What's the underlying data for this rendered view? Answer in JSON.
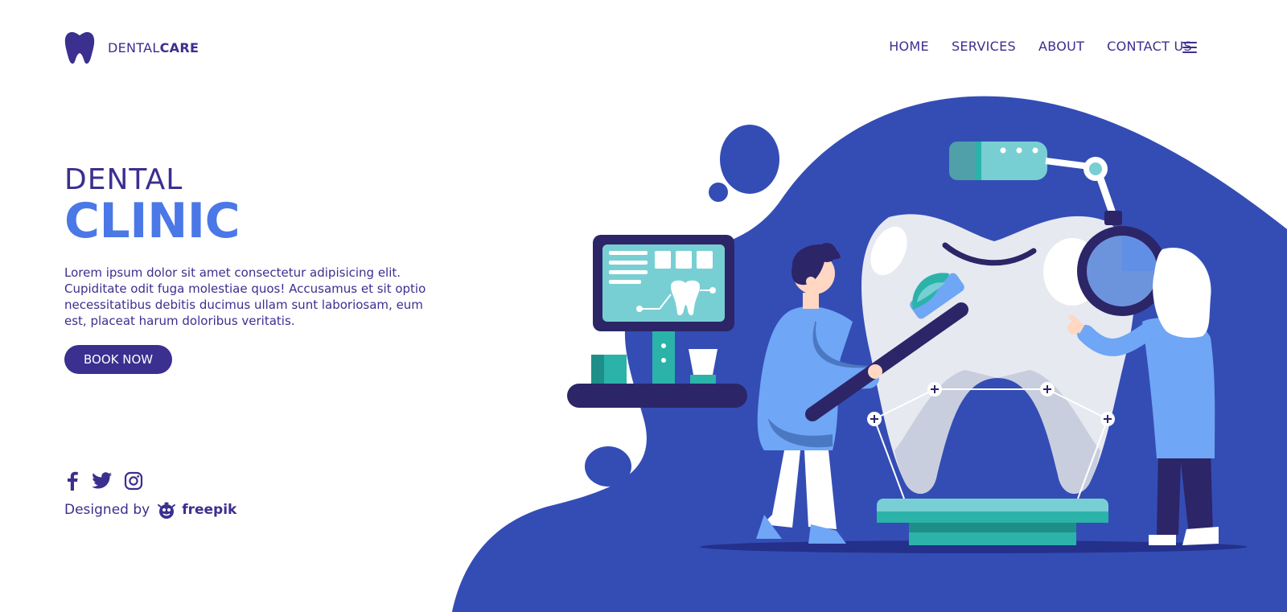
{
  "brand": {
    "name_light": "DENTAL",
    "name_bold": "CARE",
    "logo_icon": "tooth-icon"
  },
  "nav": {
    "items": [
      {
        "label": "HOME"
      },
      {
        "label": "SERVICES"
      },
      {
        "label": "ABOUT"
      },
      {
        "label": "CONTACT US"
      }
    ],
    "menu_icon": "hamburger-menu-icon"
  },
  "hero": {
    "line1": "DENTAL",
    "line2": "CLINIC",
    "description": "Lorem ipsum dolor sit amet consectetur adipisicing elit. Cupiditate odit fuga molestiae quos! Accusamus et sit optio necessitatibus debitis ducimus ullam sunt laboriosam, eum est, placeat harum doloribus veritatis.",
    "cta_label": "BOOK NOW"
  },
  "social": {
    "icons": [
      "facebook-icon",
      "twitter-icon",
      "instagram-icon"
    ]
  },
  "credit": {
    "prefix": "Designed by",
    "brand": "freepik"
  },
  "colors": {
    "primary": "#3b2f8f",
    "accent": "#4a78e6",
    "blob": "#344db5",
    "teal": "#2bb3aa",
    "light_teal": "#78cfd3",
    "tooth": "#e6e9f0"
  }
}
